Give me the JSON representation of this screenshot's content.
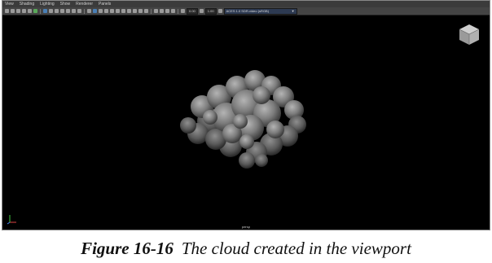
{
  "menu": [
    "View",
    "Shading",
    "Lighting",
    "Show",
    "Renderer",
    "Panels"
  ],
  "toolbar": {
    "exposure_value": "0.00",
    "gamma_value": "1.00",
    "color_space": "ACES 1.0 SDR-video (sRGB)"
  },
  "viewport": {
    "camera_label": "persp"
  },
  "caption": {
    "figure": "Figure 16-16",
    "text": "The cloud created in the viewport"
  },
  "colors": {
    "viewport_bg": "#000000",
    "menubar_bg": "#3b3b3b",
    "toolbar_bg": "#444444",
    "cloud": "#8c8c8c"
  }
}
